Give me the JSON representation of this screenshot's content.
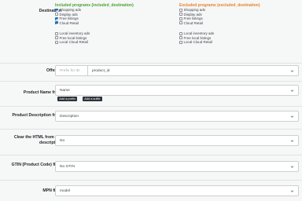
{
  "destination": {
    "label": "Destination",
    "included": {
      "heading": "Included programs (included_destination)",
      "color": "#4ca22f",
      "items": [
        {
          "label": "Shopping ads",
          "checked": true
        },
        {
          "label": "Display ads",
          "checked": false
        },
        {
          "label": "Free listings",
          "checked": true
        },
        {
          "label": "Cloud Retail",
          "checked": true
        },
        {
          "label": "Local inventory ads",
          "checked": false
        },
        {
          "label": "Free local listings",
          "checked": false
        },
        {
          "label": "Local Cloud Retail",
          "checked": false
        }
      ]
    },
    "excluded": {
      "heading": "Excluded programs (excluded_destination)",
      "color": "#e6822c",
      "items": [
        {
          "label": "Shopping ads",
          "checked": false
        },
        {
          "label": "Display ads",
          "checked": false
        },
        {
          "label": "Free listings",
          "checked": false
        },
        {
          "label": "Cloud Retail",
          "checked": false
        },
        {
          "label": "Local inventory ads",
          "checked": false
        },
        {
          "label": "Free local listings",
          "checked": false
        },
        {
          "label": "Local Cloud Retail",
          "checked": false
        }
      ]
    }
  },
  "offer_id": {
    "label": "Offer ID",
    "prefix_placeholder": "Prefix for ID",
    "value": "product_id"
  },
  "product_name": {
    "label": "Product Name from",
    "value": "Name",
    "add_prefix": "Add a prefix",
    "add_suffix": "Add a suffix"
  },
  "product_description": {
    "label": "Product Description from",
    "value": "Description"
  },
  "clear_html": {
    "label": "Clear the HTML from the description",
    "value": "No"
  },
  "gtin": {
    "label": "GTIN (Product Code) field",
    "value": "No GTIN"
  },
  "mpn": {
    "label": "MPN field",
    "value": "model"
  },
  "icons": {
    "dropdown": "chevron-down-icon",
    "checkbox": "checkbox-icon"
  }
}
